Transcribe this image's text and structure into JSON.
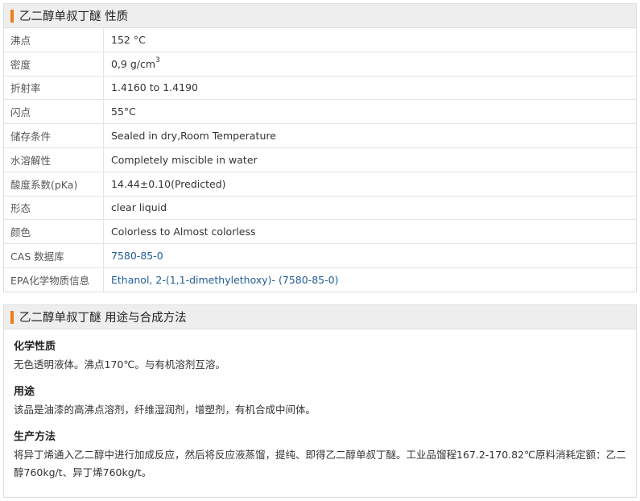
{
  "properties_section": {
    "title": "乙二醇单叔丁醚 性质",
    "rows": [
      {
        "label": "沸点",
        "value": "152 °C"
      },
      {
        "label": "密度",
        "value": "0,9 g/cm",
        "sup": "3"
      },
      {
        "label": "折射率",
        "value": "1.4160 to 1.4190"
      },
      {
        "label": "闪点",
        "value": "55°C"
      },
      {
        "label": "储存条件",
        "value": "Sealed in dry,Room Temperature"
      },
      {
        "label": "水溶解性",
        "value": "Completely miscible in water"
      },
      {
        "label": "酸度系数(pKa)",
        "value": "14.44±0.10(Predicted)"
      },
      {
        "label": "形态",
        "value": "clear liquid"
      },
      {
        "label": "颜色",
        "value": "Colorless to Almost colorless"
      },
      {
        "label": "CAS 数据库",
        "value": "7580-85-0",
        "link": true
      },
      {
        "label": "EPA化学物质信息",
        "value": "Ethanol, 2-(1,1-dimethylethoxy)- (7580-85-0)",
        "link": true
      }
    ]
  },
  "usage_section": {
    "title": "乙二醇单叔丁醚 用途与合成方法",
    "blocks": [
      {
        "heading": "化学性质",
        "text": "无色透明液体。沸点170℃。与有机溶剂互溶。"
      },
      {
        "heading": "用途",
        "text": "该品是油漆的高沸点溶剂，纤维湿润剂，增塑剂，有机合成中间体。"
      },
      {
        "heading": "生产方法",
        "text": "将异丁烯通入乙二醇中进行加成反应，然后将反应液蒸馏，提纯、即得乙二醇单叔丁醚。工业品馏程167.2-170.82℃原料消耗定额：乙二醇760kg/t、异丁烯760kg/t。"
      }
    ]
  },
  "colors": {
    "accent": "#f07d14",
    "link": "#1f5d96",
    "header_bg": "#eeeeee"
  }
}
